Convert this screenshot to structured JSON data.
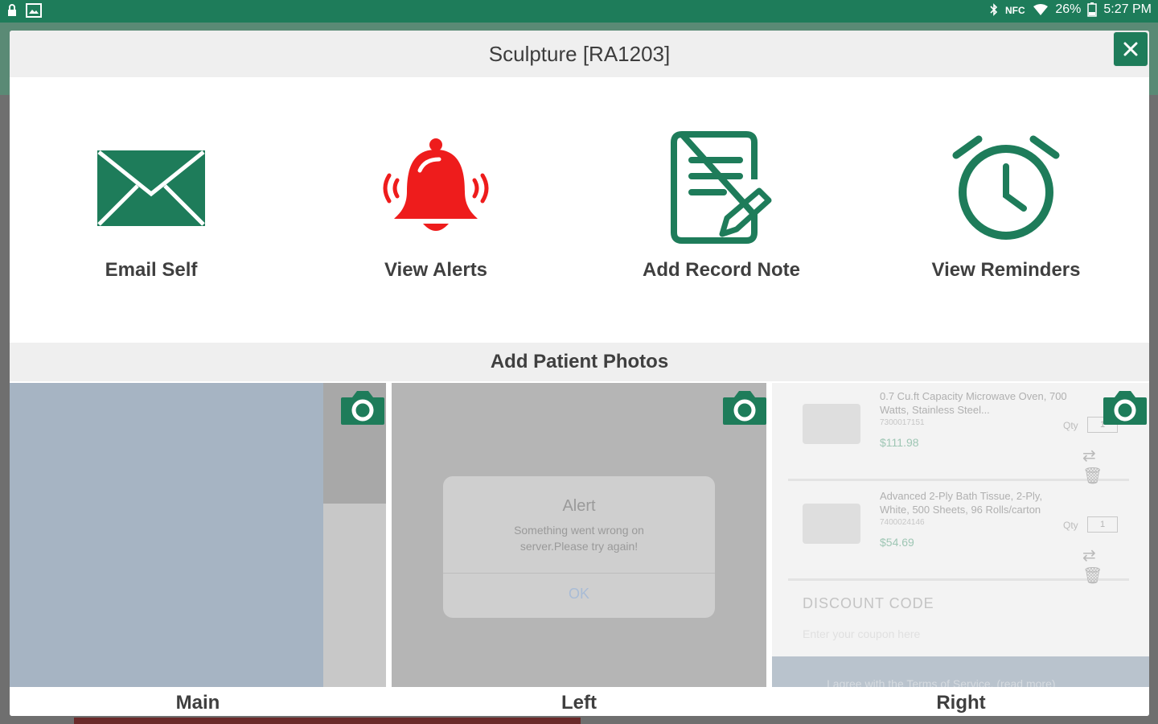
{
  "statusbar": {
    "battery_pct": "26%",
    "time": "5:27 PM"
  },
  "modal": {
    "title": "Sculpture [RA1203]",
    "close_label": "×"
  },
  "actions": [
    {
      "label": "Email Self",
      "icon": "envelope-icon"
    },
    {
      "label": "View Alerts",
      "icon": "bell-icon"
    },
    {
      "label": "Add Record Note",
      "icon": "note-pencil-icon"
    },
    {
      "label": "View Reminders",
      "icon": "alarm-clock-icon"
    }
  ],
  "photos": {
    "title": "Add Patient Photos",
    "slots": [
      {
        "label": "Main"
      },
      {
        "label": "Left"
      },
      {
        "label": "Right"
      }
    ],
    "left_preview": {
      "alert_title": "Alert",
      "alert_message": "Something went wrong on server.Please try again!",
      "alert_button": "OK"
    },
    "right_preview": {
      "items": [
        {
          "name": "0.7 Cu.ft Capacity Microwave Oven, 700 Watts, Stainless Steel...",
          "sku": "7300017151",
          "price": "$111.98",
          "qty_label": "Qty",
          "qty": "1"
        },
        {
          "name": "Advanced 2-Ply Bath Tissue, 2-Ply, White, 500 Sheets, 96 Rolls/carton",
          "sku": "7400024146",
          "price": "$54.69",
          "qty_label": "Qty",
          "qty": "1"
        }
      ],
      "discount_label": "DISCOUNT CODE",
      "discount_placeholder": "Enter your coupon here",
      "terms": "I agree with the Terms of Service. (read more)"
    }
  },
  "colors": {
    "brand_green": "#1e7c5a",
    "alert_red": "#ee1c1c"
  }
}
